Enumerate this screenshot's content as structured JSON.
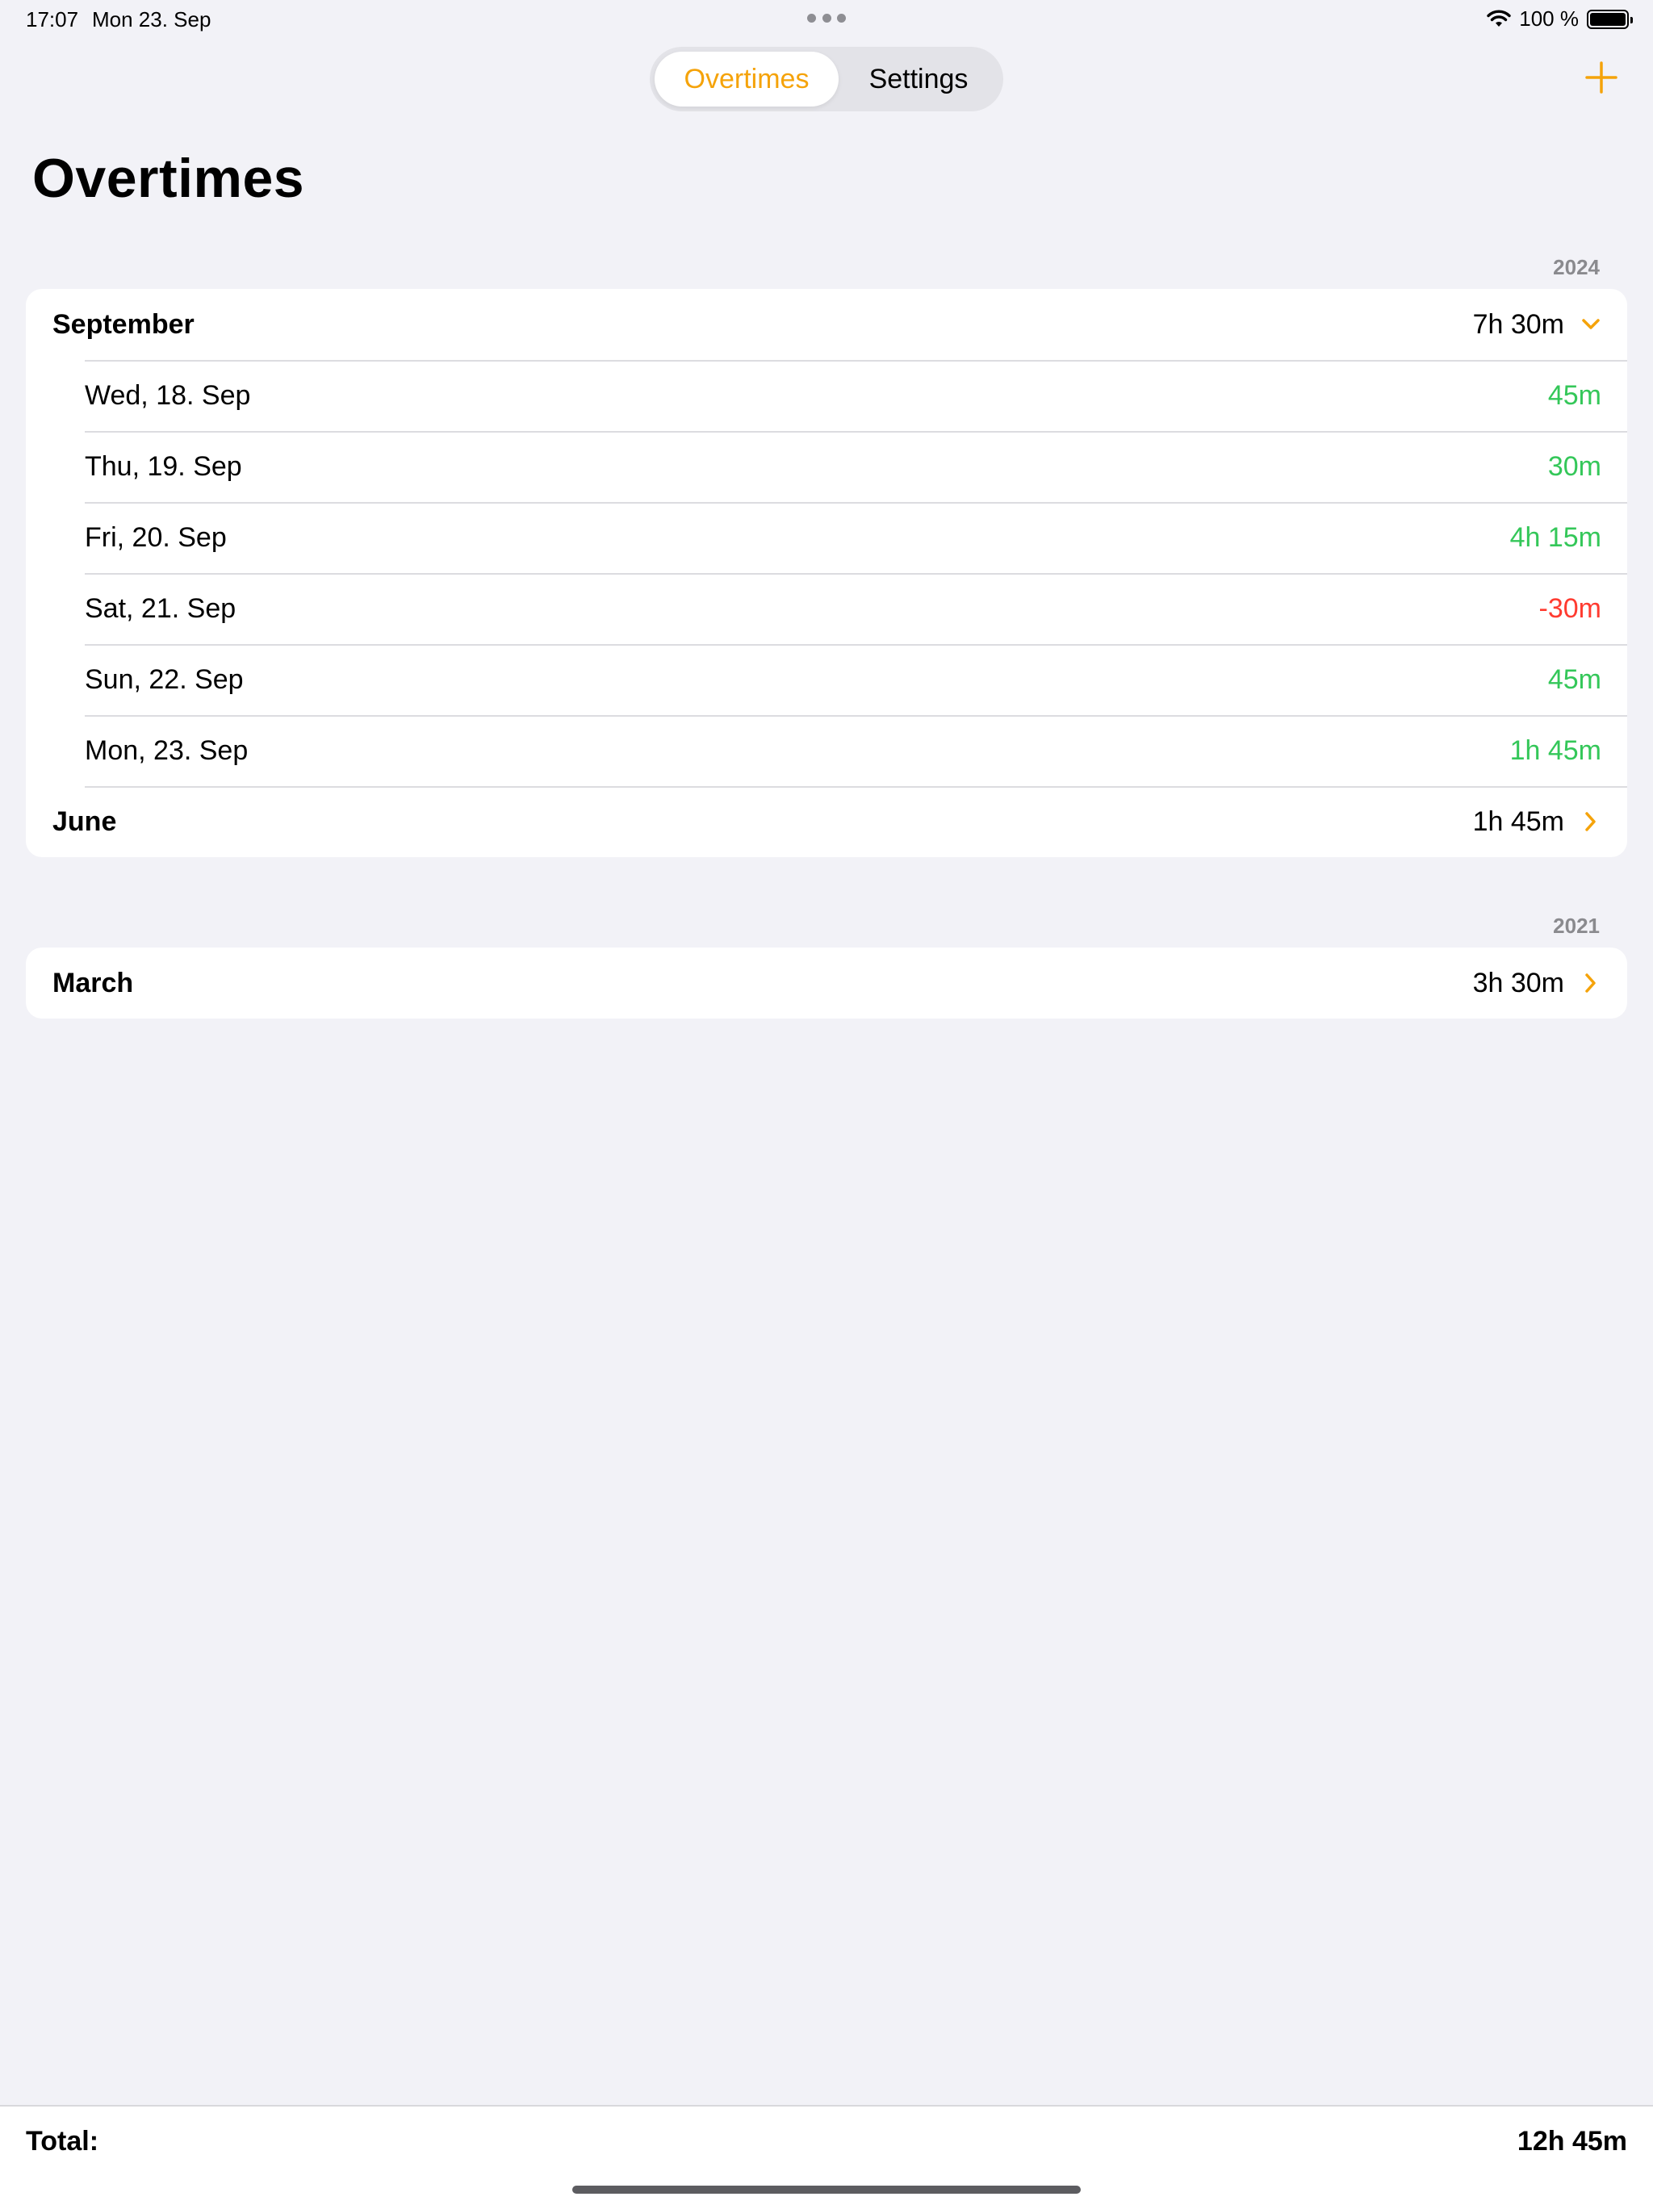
{
  "status_bar": {
    "time": "17:07",
    "date": "Mon 23. Sep",
    "battery": "100 %",
    "wifi_icon": "wifi-icon",
    "battery_icon": "battery-icon"
  },
  "segmented": {
    "tabs": [
      {
        "label": "Overtimes",
        "active": true
      },
      {
        "label": "Settings",
        "active": false
      }
    ]
  },
  "toolbar": {
    "add_icon": "plus-icon"
  },
  "title": "Overtimes",
  "colors": {
    "accent": "#f5a30a",
    "positive": "#34c759",
    "negative": "#ff3b30"
  },
  "years": [
    {
      "year": "2024",
      "months": [
        {
          "name": "September",
          "total": "7h 30m",
          "expanded": true,
          "days": [
            {
              "label": "Wed, 18. Sep",
              "value": "45m",
              "sign": "positive"
            },
            {
              "label": "Thu, 19. Sep",
              "value": "30m",
              "sign": "positive"
            },
            {
              "label": "Fri, 20. Sep",
              "value": "4h 15m",
              "sign": "positive"
            },
            {
              "label": "Sat, 21. Sep",
              "value": "-30m",
              "sign": "negative"
            },
            {
              "label": "Sun, 22. Sep",
              "value": "45m",
              "sign": "positive"
            },
            {
              "label": "Mon, 23. Sep",
              "value": "1h 45m",
              "sign": "positive"
            }
          ]
        },
        {
          "name": "June",
          "total": "1h 45m",
          "expanded": false
        }
      ]
    },
    {
      "year": "2021",
      "months": [
        {
          "name": "March",
          "total": "3h 30m",
          "expanded": false
        }
      ]
    }
  ],
  "footer": {
    "label": "Total:",
    "value": "12h 45m"
  }
}
